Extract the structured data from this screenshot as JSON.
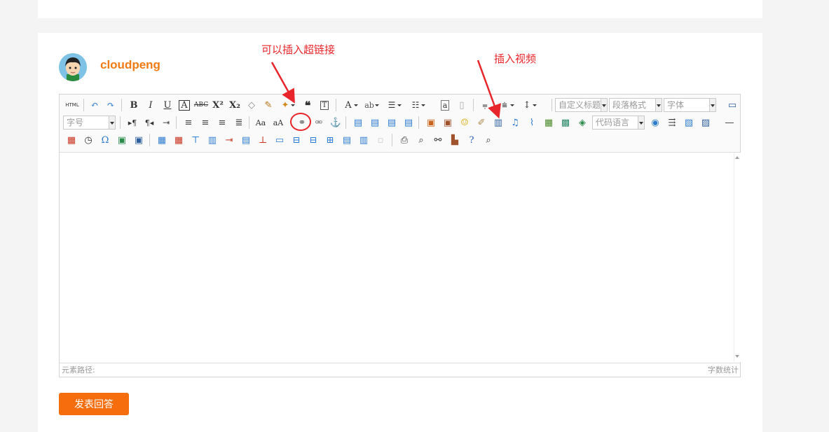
{
  "user": {
    "name": "cloudpeng"
  },
  "annotations": {
    "link_note": "可以插入超链接",
    "video_note": "插入视频"
  },
  "toolbar": {
    "html_label": "HTML",
    "custom_title_placeholder": "自定义标题",
    "paragraph_placeholder": "段落格式",
    "font_placeholder": "字体",
    "font_size_placeholder": "字号",
    "code_lang_placeholder": "代码语言"
  },
  "statusbar": {
    "path_label": "元素路径:",
    "word_count_label": "字数统计"
  },
  "submit_label": "发表回答",
  "colors": {
    "accent": "#f56d0c",
    "annotation": "#e8252a",
    "username": "#f07a14"
  }
}
